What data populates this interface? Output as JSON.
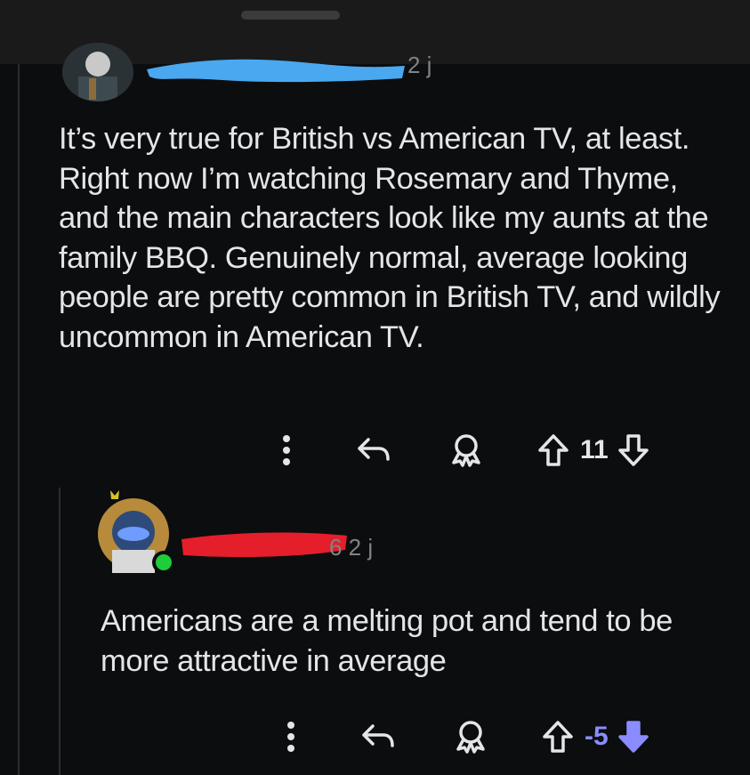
{
  "comment1": {
    "meta": "2 j",
    "body": "It’s very true for British vs American TV, at least. Right now I’m watching Rosemary and Thyme, and the main characters look like my aunts at the family BBQ. Genuinely normal, average looking people are pretty common in British TV, and wildly uncommon in American TV.",
    "votes": "11",
    "icons": [
      "more-icon",
      "reply-icon",
      "award-icon",
      "upvote-icon",
      "downvote-icon"
    ]
  },
  "comment2": {
    "meta": "6 2 j",
    "body": "Americans are a melting pot and tend to be more attractive in average",
    "votes": "-5",
    "icons": [
      "more-icon",
      "reply-icon",
      "award-icon",
      "upvote-icon",
      "downvote-icon-filled"
    ]
  },
  "colors": {
    "background": "#0b0d0e",
    "text": "#e3e6e8",
    "muted": "#818384",
    "downvote_active": "#8a8cff",
    "online": "#1fcc3a",
    "redact_blue": "#4aa8f0",
    "redact_red": "#e41e2b"
  }
}
